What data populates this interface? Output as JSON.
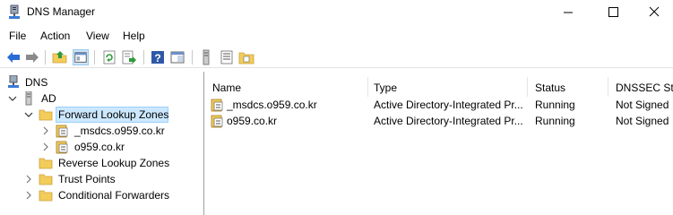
{
  "window": {
    "title": "DNS Manager",
    "icon": "dns-manager-icon"
  },
  "menu": {
    "items": [
      "File",
      "Action",
      "View",
      "Help"
    ]
  },
  "toolbar": {
    "buttons": [
      "back-icon",
      "forward-icon",
      "up-folder-icon",
      "show-hide-console-tree-icon",
      "refresh-icon",
      "export-list-icon",
      "help-icon",
      "properties-icon",
      "server-icon",
      "records-icon",
      "zone-icon"
    ]
  },
  "tree": {
    "root": "DNS",
    "server": "AD",
    "forward_zones": "Forward Lookup Zones",
    "zone1": "_msdcs.o959.co.kr",
    "zone2": "o959.co.kr",
    "reverse_zones": "Reverse Lookup Zones",
    "trust_points": "Trust Points",
    "conditional_forwarders": "Conditional Forwarders"
  },
  "list": {
    "columns": [
      "Name",
      "Type",
      "Status",
      "DNSSEC Stat"
    ],
    "rows": [
      {
        "name": "_msdcs.o959.co.kr",
        "type": "Active Directory-Integrated Pr...",
        "status": "Running",
        "dnssec": "Not Signed"
      },
      {
        "name": "o959.co.kr",
        "type": "Active Directory-Integrated Pr...",
        "status": "Running",
        "dnssec": "Not Signed"
      }
    ]
  },
  "colors": {
    "selection": "#cce8ff",
    "folder": "#f4cc5a",
    "accent_blue": "#2a6ad4"
  }
}
